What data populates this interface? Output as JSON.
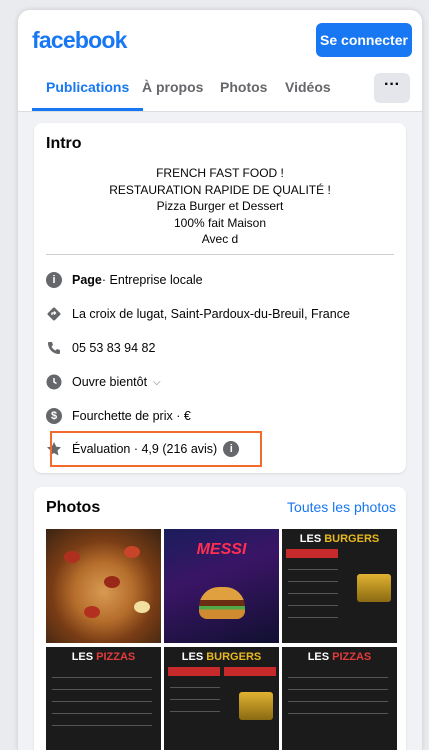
{
  "header": {
    "logo": "facebook",
    "connect_label": "Se connecter"
  },
  "tabs": [
    {
      "label": "Publications",
      "active": true
    },
    {
      "label": "À propos"
    },
    {
      "label": "Photos"
    },
    {
      "label": "Vidéos"
    }
  ],
  "more_label": "···",
  "intro": {
    "title": "Intro",
    "bio_lines": [
      "FRENCH FAST FOOD !",
      "RESTAURATION RAPIDE DE QUALITÉ !",
      "Pizza Burger et Dessert",
      "100% fait Maison",
      "Avec d"
    ],
    "page_label": "Page",
    "page_category": " · Entreprise locale",
    "address": "La croix de lugat, Saint-Pardoux-du-Breuil, France",
    "phone": "05 53 83 94 82",
    "hours": "Ouvre bientôt",
    "price": "Fourchette de prix · €",
    "rating": "Évaluation · 4,9 (216 avis)"
  },
  "photos": {
    "title": "Photos",
    "see_all": "Toutes les photos",
    "tiles": [
      {
        "kind": "pizza"
      },
      {
        "kind": "poster",
        "caption": "MESSI"
      },
      {
        "kind": "menu",
        "caption_a": "LES ",
        "caption_b": "BURGERS"
      },
      {
        "kind": "menu",
        "caption_a": "LES ",
        "caption_b": "PIZZAS"
      },
      {
        "kind": "menu",
        "caption_a": "LES ",
        "caption_b": "BURGERS"
      },
      {
        "kind": "menu",
        "caption_a": "LES ",
        "caption_b": "PIZZAS"
      }
    ]
  },
  "colors": {
    "brand": "#1877f2",
    "highlight": "#f26b2b"
  }
}
